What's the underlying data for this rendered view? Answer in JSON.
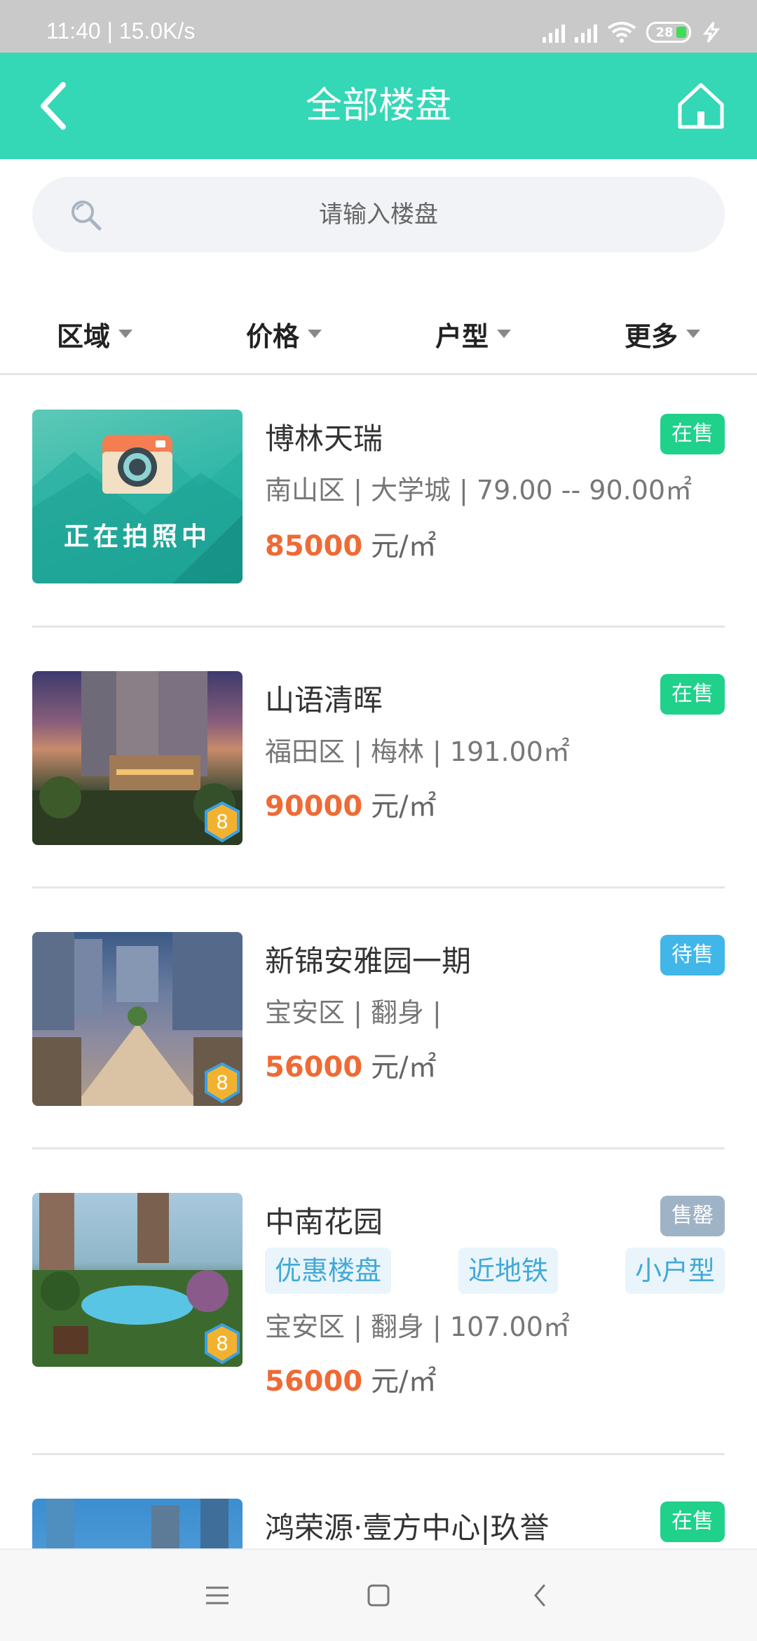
{
  "status_bar": {
    "time_speed": "11:40 | 15.0K/s",
    "battery": "28"
  },
  "header": {
    "title": "全部楼盘",
    "back_icon": "chevron-left-icon",
    "home_icon": "home-icon"
  },
  "search": {
    "placeholder": "请输入楼盘",
    "value": ""
  },
  "filters": [
    {
      "label": "区域"
    },
    {
      "label": "价格"
    },
    {
      "label": "户型"
    },
    {
      "label": "更多"
    }
  ],
  "listings": [
    {
      "name": "博林天瑞",
      "status": "在售",
      "meta": "南山区 | 大学城 | 79.00 -- 90.00㎡",
      "price": "85000",
      "unit": "元/㎡",
      "thumb_text": "正在拍照中",
      "medal": ""
    },
    {
      "name": "山语清晖",
      "status": "在售",
      "meta": "福田区 | 梅林 | 191.00㎡",
      "price": "90000",
      "unit": "元/㎡",
      "medal": "8"
    },
    {
      "name": "新锦安雅园一期",
      "status": "待售",
      "meta": "宝安区 | 翻身 |",
      "price": "56000",
      "unit": "元/㎡",
      "medal": "8"
    },
    {
      "name": "中南花园",
      "status": "售罄",
      "tags": [
        "优惠楼盘",
        "近地铁",
        "小户型"
      ],
      "meta": "宝安区 | 翻身 | 107.00㎡",
      "price": "56000",
      "unit": "元/㎡",
      "medal": "8"
    },
    {
      "name": "鸿荣源·壹方中心|玖誉",
      "status": "在售"
    }
  ],
  "colors": {
    "accent": "#34d7b6",
    "price": "#ef6a35",
    "status_on_sale": "#1fd18a",
    "status_pending": "#41b6e8",
    "status_sold_out": "#9fb3c7"
  }
}
